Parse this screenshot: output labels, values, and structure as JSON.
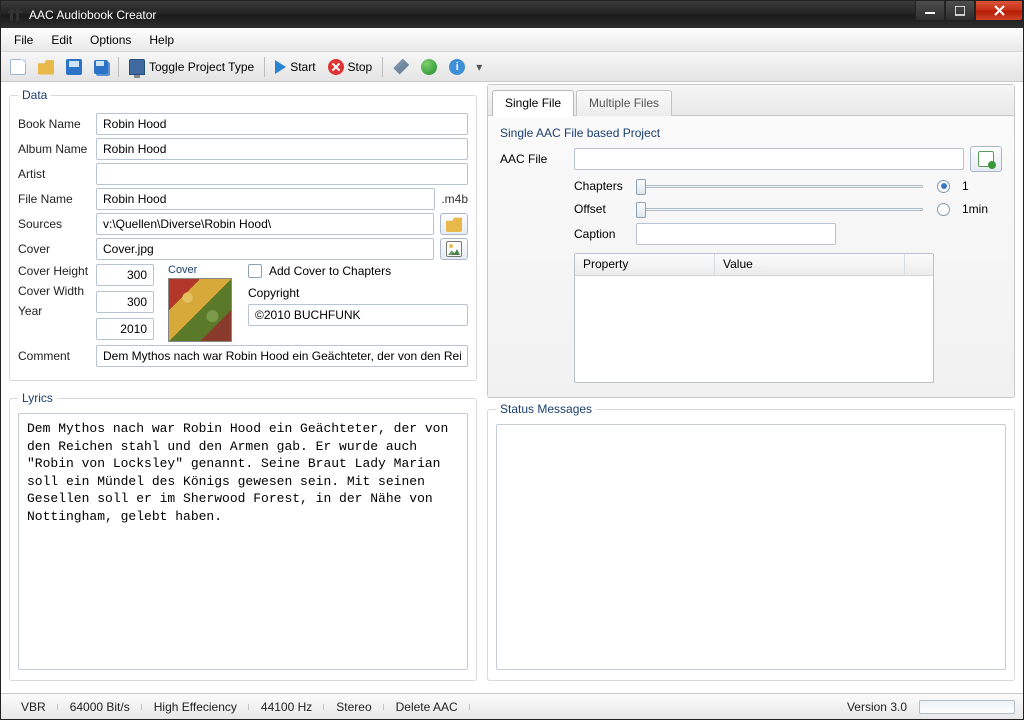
{
  "window": {
    "title": "AAC Audiobook Creator"
  },
  "menu": {
    "file": "File",
    "edit": "Edit",
    "options": "Options",
    "help": "Help"
  },
  "toolbar": {
    "toggle": "Toggle Project Type",
    "start": "Start",
    "stop": "Stop"
  },
  "groups": {
    "data": "Data",
    "lyrics": "Lyrics",
    "single_project": "Single AAC File based Project",
    "status": "Status Messages"
  },
  "labels": {
    "book_name": "Book Name",
    "album_name": "Album Name",
    "artist": "Artist",
    "file_name": "File Name",
    "m4b": ".m4b",
    "sources": "Sources",
    "cover": "Cover",
    "cover_cap": "Cover",
    "cover_height": "Cover Height",
    "cover_width": "Cover Width",
    "year": "Year",
    "comment": "Comment",
    "add_cover": "Add Cover to Chapters",
    "copyright": "Copyright",
    "aac_file": "AAC File",
    "chapters": "Chapters",
    "offset": "Offset",
    "caption": "Caption",
    "property": "Property",
    "value": "Value"
  },
  "values": {
    "book_name": "Robin Hood",
    "album_name": "Robin Hood",
    "artist": "",
    "file_name": "Robin Hood",
    "sources": "v:\\Quellen\\Diverse\\Robin Hood\\",
    "cover": "Cover.jpg",
    "cover_height": "300",
    "cover_width": "300",
    "year": "2010",
    "copyright": "©2010 BUCHFUNK",
    "comment": "Dem Mythos nach war Robin Hood ein Geächteter, der von den Reichen stahl und den Armen gab. Er wurde auch \"Robin von Locksley\" genannt. Seine Braut Lady Marian soll ein Mündel des Königs gewesen sein. Mit seinen Gesellen soll er im Sherwood Forest, in der Nähe von Nottingham, gelebt haben.",
    "lyrics": "Dem Mythos nach war Robin Hood ein Geächteter, der von den Reichen stahl und den Armen gab. Er wurde auch \"Robin von Locksley\" genannt. Seine Braut Lady Marian soll ein Mündel des Königs gewesen sein. Mit seinen Gesellen soll er im Sherwood Forest, in der Nähe von Nottingham, gelebt haben.",
    "chapters": "1",
    "offset": "1min",
    "caption": ""
  },
  "tabs": {
    "single": "Single File",
    "multiple": "Multiple Files"
  },
  "status": {
    "vbr": "VBR",
    "bitrate": "64000 Bit/s",
    "eff": "High Effeciency",
    "hz": "44100 Hz",
    "stereo": "Stereo",
    "delete": "Delete AAC",
    "version": "Version 3.0"
  }
}
